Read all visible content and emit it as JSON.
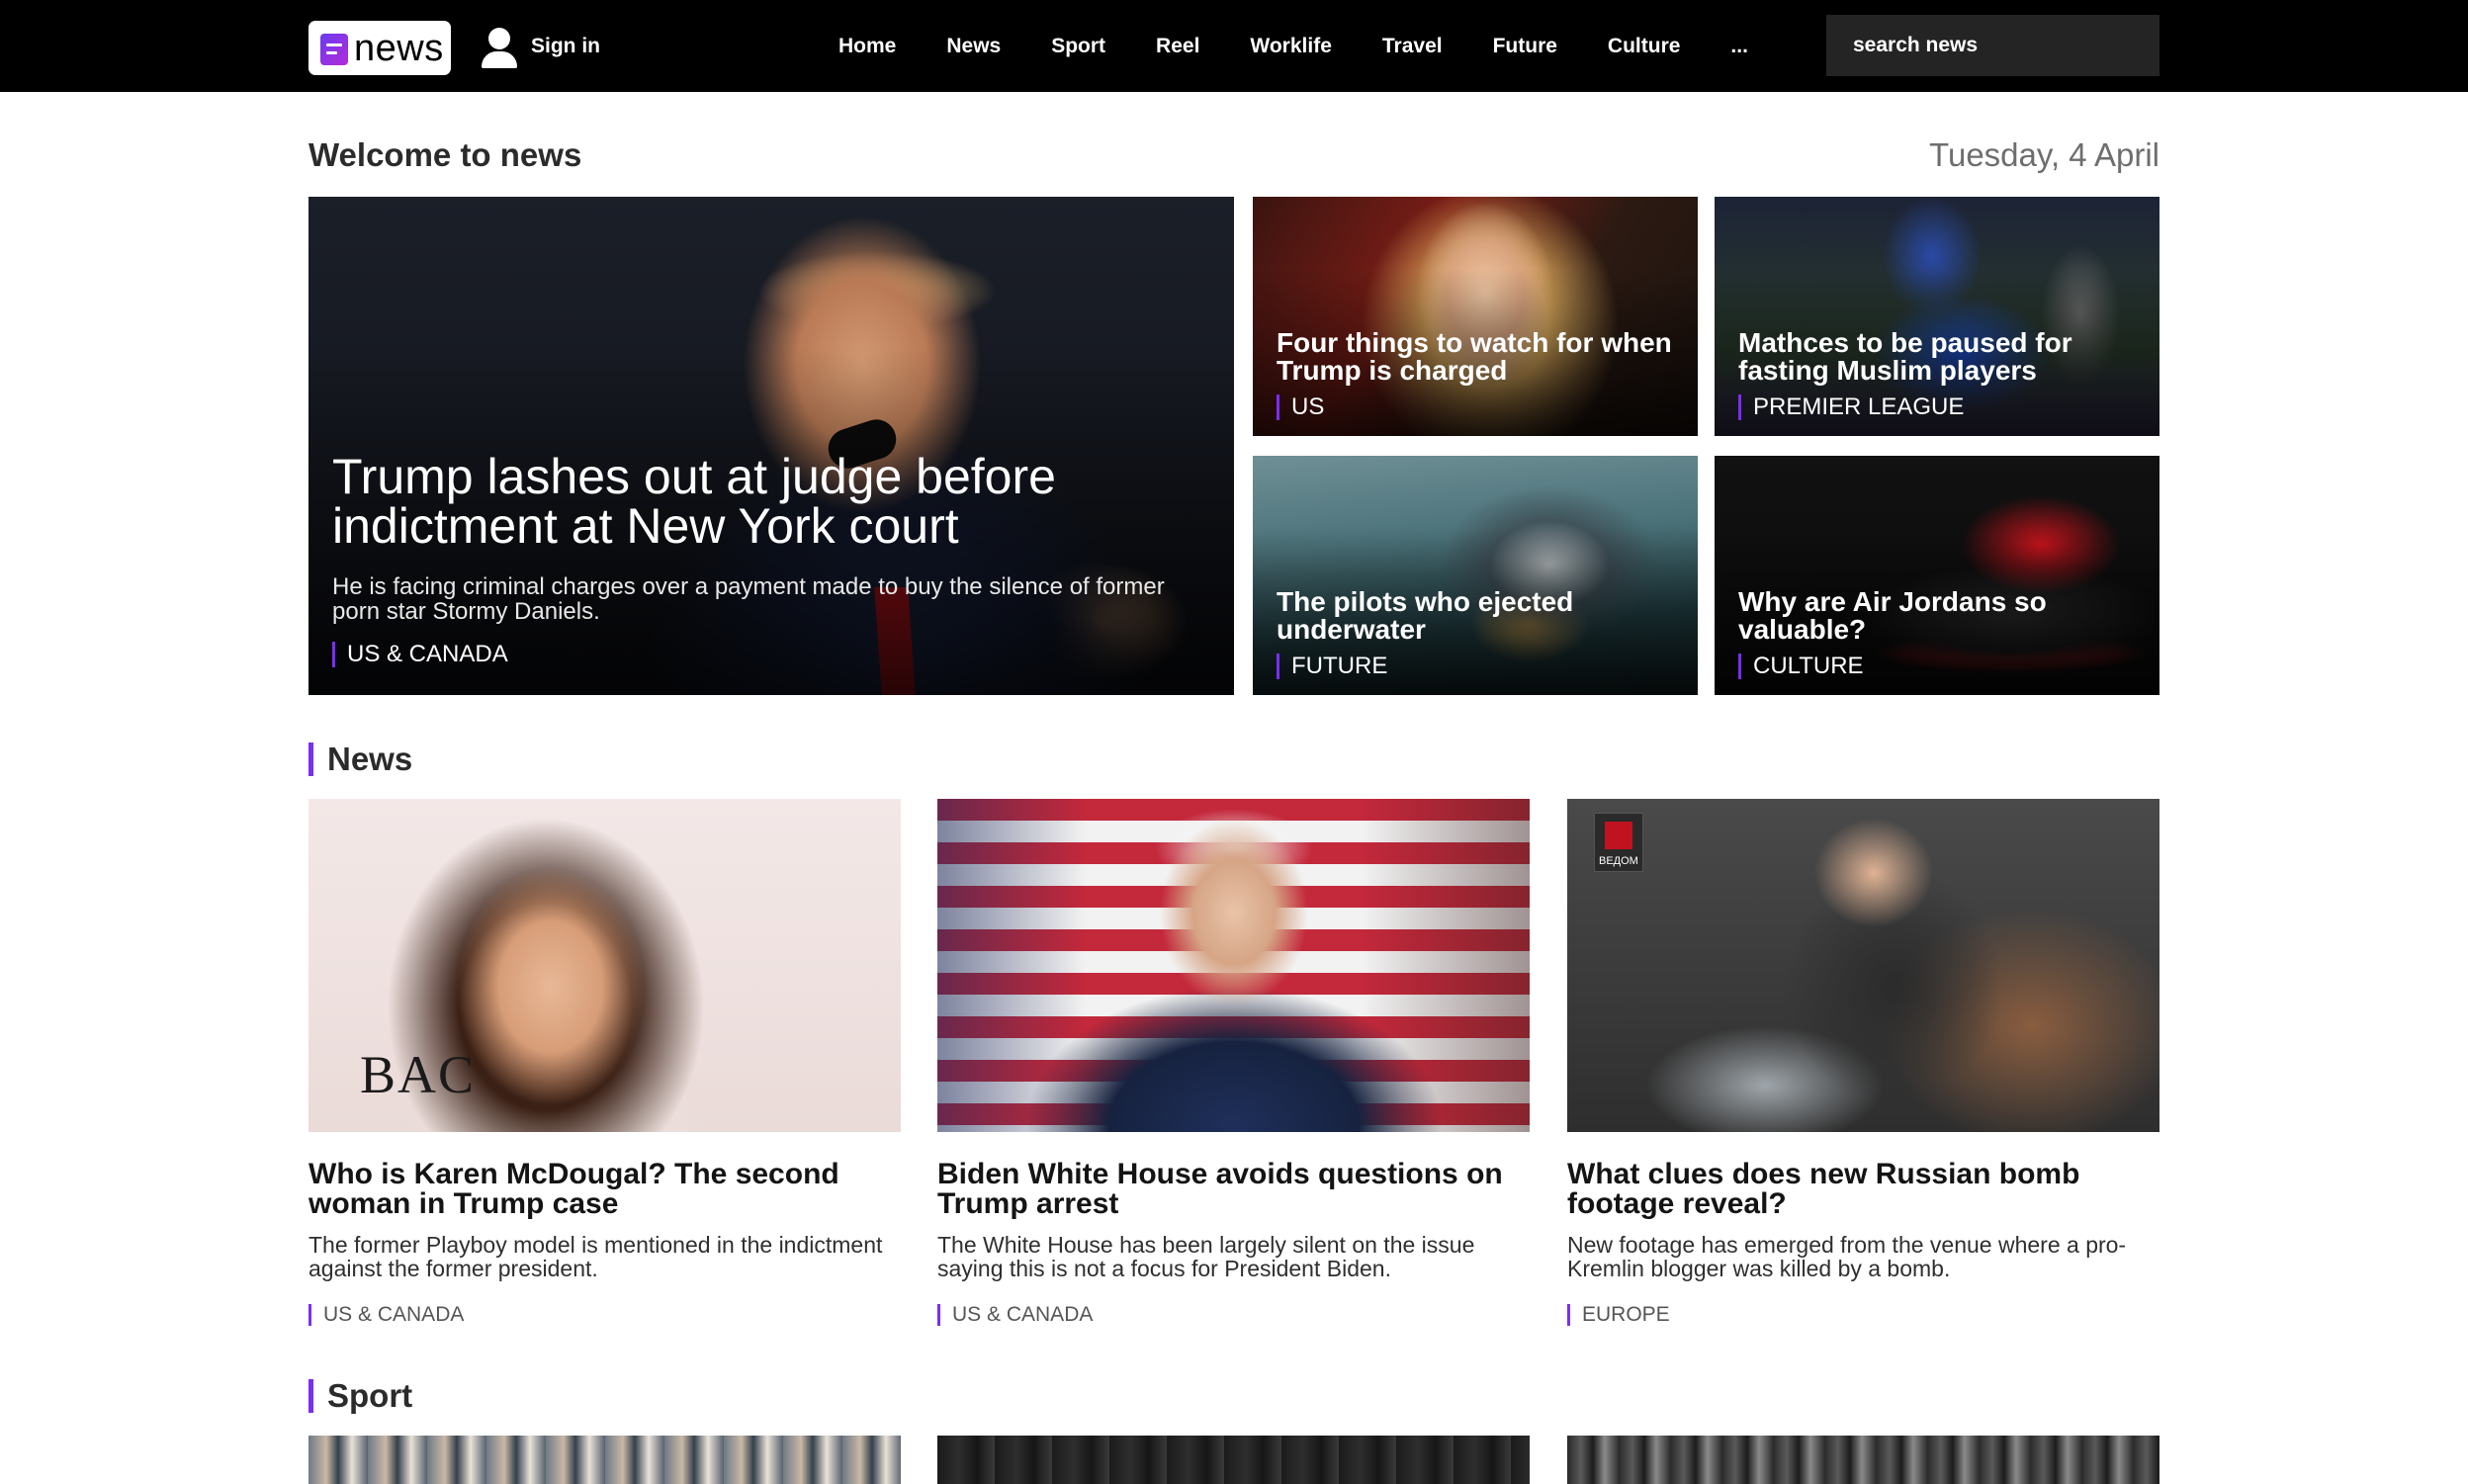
{
  "header": {
    "logo_text": "news",
    "signin_label": "Sign in",
    "nav": [
      "Home",
      "News",
      "Sport",
      "Reel",
      "Worklife",
      "Travel",
      "Future",
      "Culture",
      "..."
    ],
    "search_placeholder": "search news"
  },
  "welcome": {
    "title": "Welcome to news",
    "date": "Tuesday, 4 April"
  },
  "hero": {
    "main": {
      "title": "Trump lashes out at judge before indictment at New York court",
      "summary": "He is facing criminal charges over a payment made to buy the silence of former porn star Stormy Daniels.",
      "tag": "US & CANADA"
    },
    "tiles": [
      {
        "title": "Four things to watch for when Trump is charged",
        "tag": "US"
      },
      {
        "title": "Mathces to be paused for fasting Muslim players",
        "tag": "PREMIER LEAGUE"
      },
      {
        "title": "The pilots who ejected underwater",
        "tag": "FUTURE"
      },
      {
        "title": "Why are Air Jordans so valuable?",
        "tag": "CULTURE"
      }
    ]
  },
  "sections": {
    "news": {
      "title": "News",
      "articles": [
        {
          "title": "Who is Karen McDougal? The second woman in Trump case",
          "summary": "The former Playboy model is mentioned in the indictment against the former president.",
          "tag": "US & CANADA"
        },
        {
          "title": "Biden White House avoids questions on Trump arrest",
          "summary": "The White House has been largely silent on the issue saying this is not a focus for President Biden.",
          "tag": "US & CANADA"
        },
        {
          "title": "What clues does new Russian bomb footage reveal?",
          "summary": "New footage has emerged from the venue where a pro-Kremlin blogger was killed by a bomb.",
          "tag": "EUROPE"
        }
      ]
    },
    "sport": {
      "title": "Sport"
    }
  },
  "image_text": {
    "thumb_1_brand": "BAC",
    "thumb_3_badge": "ВЕДОМ"
  },
  "colors": {
    "topbar": "#000000",
    "accent": "#7a2ef0",
    "search_bg": "#242424"
  }
}
